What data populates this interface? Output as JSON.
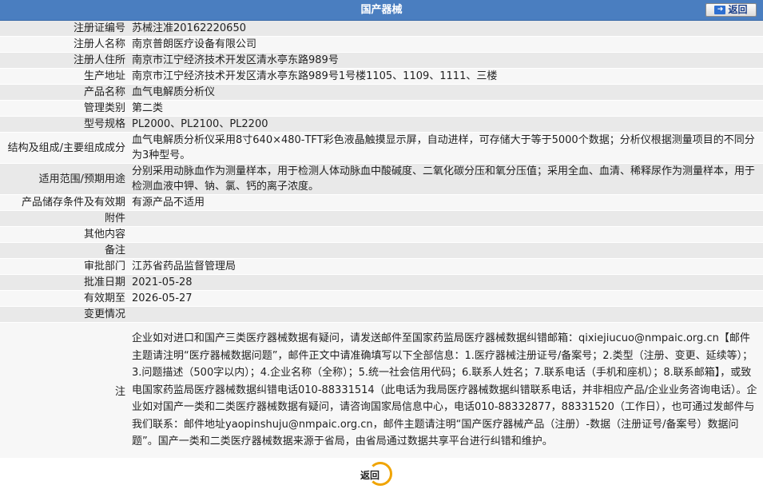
{
  "header": {
    "title": "国产器械",
    "back_label": "返回"
  },
  "rows": [
    {
      "label": "注册证编号",
      "value": "苏械注准20162220650"
    },
    {
      "label": "注册人名称",
      "value": "南京普朗医疗设备有限公司"
    },
    {
      "label": "注册人住所",
      "value": "南京市江宁经济技术开发区清水亭东路989号"
    },
    {
      "label": "生产地址",
      "value": "南京市江宁经济技术开发区清水亭东路989号1号楼1105、1109、1111、三楼"
    },
    {
      "label": "产品名称",
      "value": "血气电解质分析仪"
    },
    {
      "label": "管理类别",
      "value": "第二类"
    },
    {
      "label": "型号规格",
      "value": "PL2000、PL2100、PL2200"
    },
    {
      "label": "结构及组成/主要组成成分",
      "value": "血气电解质分析仪采用8寸640×480-TFT彩色液晶触摸显示屏，自动进样，可存储大于等于5000个数据；分析仪根据测量项目的不同分为3种型号。"
    },
    {
      "label": "适用范围/预期用途",
      "value": "分别采用动脉血作为测量样本，用于检测人体动脉血中酸碱度、二氧化碳分压和氧分压值；采用全血、血清、稀释尿作为测量样本，用于检测血液中钾、钠、氯、钙的离子浓度。"
    },
    {
      "label": "产品储存条件及有效期",
      "value": "有源产品不适用"
    },
    {
      "label": "附件",
      "value": ""
    },
    {
      "label": "其他内容",
      "value": ""
    },
    {
      "label": "备注",
      "value": ""
    },
    {
      "label": "审批部门",
      "value": "江苏省药品监督管理局"
    },
    {
      "label": "批准日期",
      "value": "2021-05-28"
    },
    {
      "label": "有效期至",
      "value": "2026-05-27"
    },
    {
      "label": "变更情况",
      "value": ""
    }
  ],
  "note": {
    "label": "注",
    "text": "企业如对进口和国产三类医疗器械数据有疑问，请发送邮件至国家药监局医疗器械数据纠错邮箱：qixiejiucuo@nmpaic.org.cn【邮件主题请注明“医疗器械数据问题”，邮件正文中请准确填写以下全部信息：1.医疗器械注册证号/备案号；2.类型（注册、变更、延续等）；3.问题描述（500字以内）；4.企业名称（全称）；5.统一社会信用代码；6.联系人姓名；7.联系电话（手机和座机）；8.联系邮箱】，或致电国家药监局医疗器械数据纠错电话010-88331514（此电话为我局医疗器械数据纠错联系电话，并非相应产品/企业业务咨询电话）。企业如对国产一类和二类医疗器械数据有疑问，请咨询国家局信息中心，电话010-88332877，88331520（工作日），也可通过发邮件与我们联系：邮件地址yaopinshuju@nmpaic.org.cn，邮件主题请注明“国产医疗器械产品（注册）-数据（注册证号/备案号）数据问题”。国产一类和二类医疗器械数据来源于省局，由省局通过数据共享平台进行纠错和维护。"
  },
  "footer": {
    "back_label": "返回"
  },
  "colors": {
    "header_bg": "#4a7ec0",
    "row_odd": "#e9e9e9",
    "row_even": "#f7f7f7",
    "accent_ring": "#f0a400"
  }
}
